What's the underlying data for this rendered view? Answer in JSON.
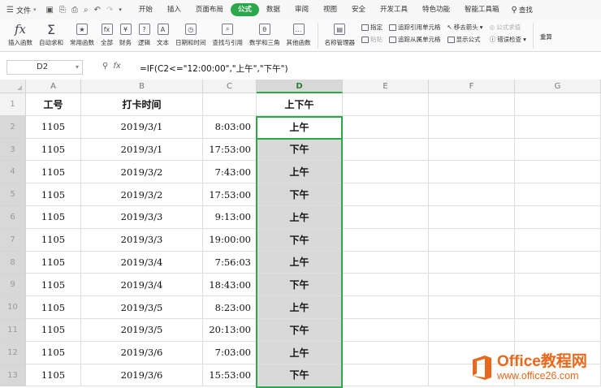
{
  "menu": {
    "file_label": "文件",
    "tabs": [
      "开始",
      "插入",
      "页面布局",
      "公式",
      "数据",
      "审阅",
      "视图",
      "安全",
      "开发工具",
      "特色功能",
      "智能工具箱"
    ],
    "active_tab": "公式",
    "find_label": "查找"
  },
  "ribbon": {
    "buttons": [
      "插入函数",
      "自动求和",
      "常用函数",
      "全部",
      "财务",
      "逻辑",
      "文本",
      "日期和时间",
      "查找与引用",
      "数学和三角",
      "其他函数",
      "名称管理器"
    ],
    "small": [
      "指定",
      "粘贴",
      "追踪引用单元格",
      "追踪从属单元格",
      "移去箭头",
      "显示公式",
      "公式求值",
      "错误检查",
      "重算"
    ]
  },
  "formula_bar": {
    "name_box": "D2",
    "formula": "=IF(C2<=\"12:00:00\",\"上午\",\"下午\")"
  },
  "grid": {
    "columns": [
      "A",
      "B",
      "C",
      "D",
      "E",
      "F",
      "G"
    ],
    "selected_column": "D",
    "header_row": {
      "A": "工号",
      "B": "打卡时间",
      "C": "",
      "D": "上下午"
    },
    "rows": [
      {
        "n": "2",
        "A": "1105",
        "B": "2019/3/1",
        "C": "8:03:00",
        "D": "上午"
      },
      {
        "n": "3",
        "A": "1105",
        "B": "2019/3/1",
        "C": "17:53:00",
        "D": "下午"
      },
      {
        "n": "4",
        "A": "1105",
        "B": "2019/3/2",
        "C": "7:43:00",
        "D": "上午"
      },
      {
        "n": "5",
        "A": "1105",
        "B": "2019/3/2",
        "C": "17:53:00",
        "D": "下午"
      },
      {
        "n": "6",
        "A": "1105",
        "B": "2019/3/3",
        "C": "9:13:00",
        "D": "上午"
      },
      {
        "n": "7",
        "A": "1105",
        "B": "2019/3/3",
        "C": "19:00:00",
        "D": "下午"
      },
      {
        "n": "8",
        "A": "1105",
        "B": "2019/3/4",
        "C": "7:56:03",
        "D": "上午"
      },
      {
        "n": "9",
        "A": "1105",
        "B": "2019/3/4",
        "C": "18:43:00",
        "D": "下午"
      },
      {
        "n": "10",
        "A": "1105",
        "B": "2019/3/5",
        "C": "8:23:00",
        "D": "上午"
      },
      {
        "n": "11",
        "A": "1105",
        "B": "2019/3/5",
        "C": "20:13:00",
        "D": "下午"
      },
      {
        "n": "12",
        "A": "1105",
        "B": "2019/3/6",
        "C": "7:03:00",
        "D": "上午"
      },
      {
        "n": "13",
        "A": "1105",
        "B": "2019/3/6",
        "C": "15:53:00",
        "D": "下午"
      }
    ]
  },
  "watermark": {
    "line1": "Office教程网",
    "line2": "www.office26.com"
  },
  "colors": {
    "accent": "#2aa84a",
    "selection_fill": "#d9d9d9",
    "watermark": "#e8691b"
  }
}
